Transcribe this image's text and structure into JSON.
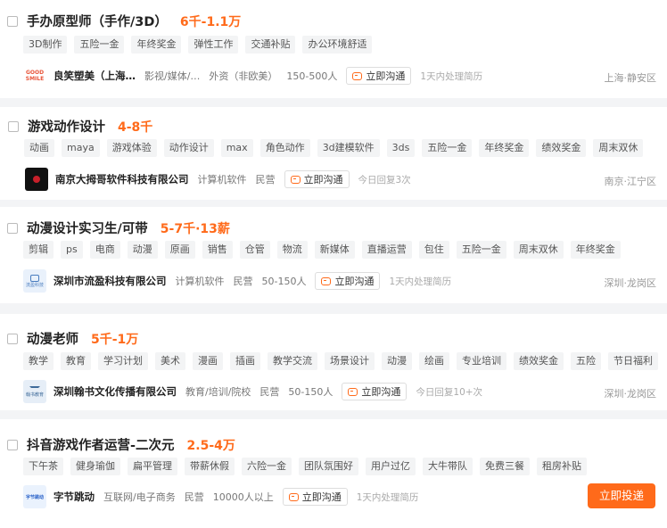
{
  "jobs": [
    {
      "title": "手办原型师（手作/3D）",
      "salary": "6千-1.1万",
      "tags": [
        "3D制作",
        "五险一金",
        "年终奖金",
        "弹性工作",
        "交通补贴",
        "办公环境舒适"
      ],
      "company": "良笑塑美（上海…",
      "industry": "影视/媒体/…",
      "type": "外资（非欧美）",
      "size": "150-500人",
      "chat_label": "立即沟通",
      "reply": "1天内处理简历",
      "location": "上海·静安区",
      "logo_text": "GOOD SMILE",
      "logo_color": "#e8553a"
    },
    {
      "title": "游戏动作设计",
      "salary": "4-8千",
      "tags": [
        "动画",
        "maya",
        "游戏体验",
        "动作设计",
        "max",
        "角色动作",
        "3d建模软件",
        "3ds",
        "五险一金",
        "年终奖金",
        "绩效奖金",
        "周末双休"
      ],
      "company": "南京大拇哥软件科技有限公司",
      "industry": "计算机软件",
      "type": "民营",
      "size": "",
      "chat_label": "立即沟通",
      "reply": "今日回复3次",
      "location": "南京·江宁区",
      "logo_text": "",
      "logo_color": "#111111"
    },
    {
      "title": "动漫设计实习生/可带",
      "salary": "5-7千·13薪",
      "tags": [
        "剪辑",
        "ps",
        "电商",
        "动漫",
        "原画",
        "销售",
        "仓管",
        "物流",
        "新媒体",
        "直播运营",
        "包住",
        "五险一金",
        "周末双休",
        "年终奖金"
      ],
      "company": "深圳市流盈科技有限公司",
      "industry": "计算机软件",
      "type": "民营",
      "size": "50-150人",
      "chat_label": "立即沟通",
      "reply": "1天内处理简历",
      "location": "深圳·龙岗区",
      "logo_text": "流盈科技",
      "logo_color": "#e9f1fb"
    },
    {
      "title": "动漫老师",
      "salary": "5千-1万",
      "tags": [
        "教学",
        "教育",
        "学习计划",
        "美术",
        "漫画",
        "插画",
        "教学交流",
        "场景设计",
        "动漫",
        "绘画",
        "专业培训",
        "绩效奖金",
        "五险",
        "节日福利"
      ],
      "company": "深圳翰书文化传播有限公司",
      "industry": "教育/培训/院校",
      "type": "民营",
      "size": "50-150人",
      "chat_label": "立即沟通",
      "reply": "今日回复10+次",
      "location": "深圳·龙岗区",
      "logo_text": "翰书教育",
      "logo_color": "#e6eef7"
    },
    {
      "title": "抖音游戏作者运营-二次元",
      "salary": "2.5-4万",
      "tags": [
        "下午茶",
        "健身瑜伽",
        "扁平管理",
        "带薪休假",
        "六险一金",
        "团队氛围好",
        "用户过亿",
        "大牛带队",
        "免费三餐",
        "租房补贴"
      ],
      "company": "字节跳动",
      "industry": "互联网/电子商务",
      "type": "民营",
      "size": "10000人以上",
      "chat_label": "立即沟通",
      "reply": "1天内处理简历",
      "location": "",
      "logo_text": "字节跳动",
      "logo_color": "#eaf2fd"
    }
  ],
  "apply_label": "立即投递"
}
